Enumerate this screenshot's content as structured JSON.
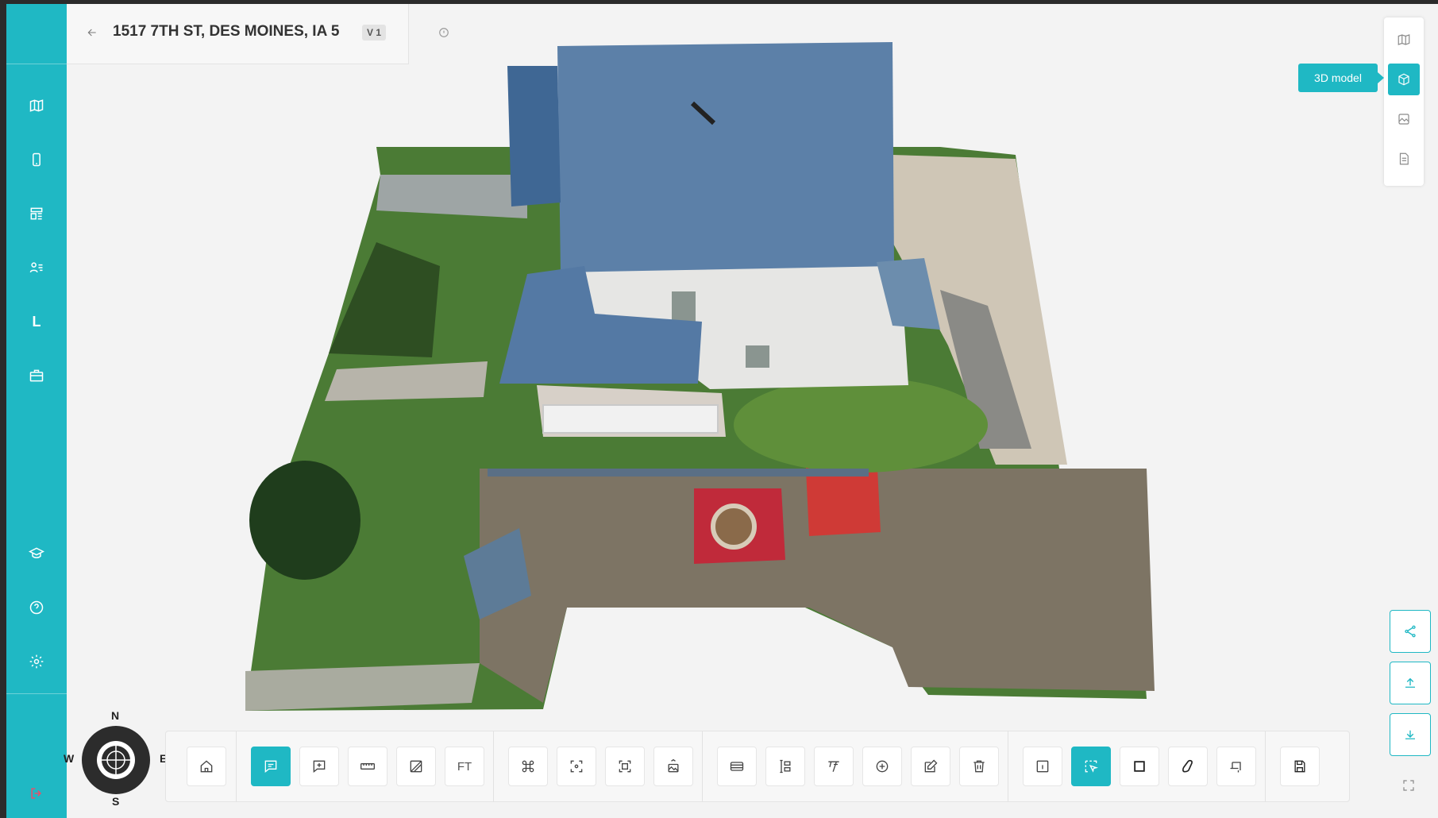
{
  "header": {
    "address": "1517 7TH ST, DES MOINES, IA 5",
    "version": "V 1"
  },
  "sidebar": {
    "items": [
      {
        "icon": "map-icon"
      },
      {
        "icon": "tablet-icon"
      },
      {
        "icon": "dashboard-icon"
      },
      {
        "icon": "users-list-icon"
      },
      {
        "icon": "letter-l-icon",
        "label": "L"
      },
      {
        "icon": "briefcase-icon"
      },
      {
        "icon": "graduation-cap-icon"
      },
      {
        "icon": "help-circle-icon"
      },
      {
        "icon": "gear-icon"
      },
      {
        "icon": "logout-icon"
      }
    ]
  },
  "view_switcher": {
    "items": [
      "map-icon",
      "cube-icon",
      "image-icon",
      "document-icon"
    ],
    "active": "cube-icon",
    "tooltip": "3D model"
  },
  "compass": {
    "n": "N",
    "s": "S",
    "e": "E",
    "w": "W"
  },
  "toolbar": {
    "ft_label": "FT",
    "active_tools": [
      "comment-tool",
      "select-tool"
    ]
  },
  "colors": {
    "accent": "#1fb8c4",
    "roof": "#5b7fa6",
    "grass": "#4a7a35"
  }
}
